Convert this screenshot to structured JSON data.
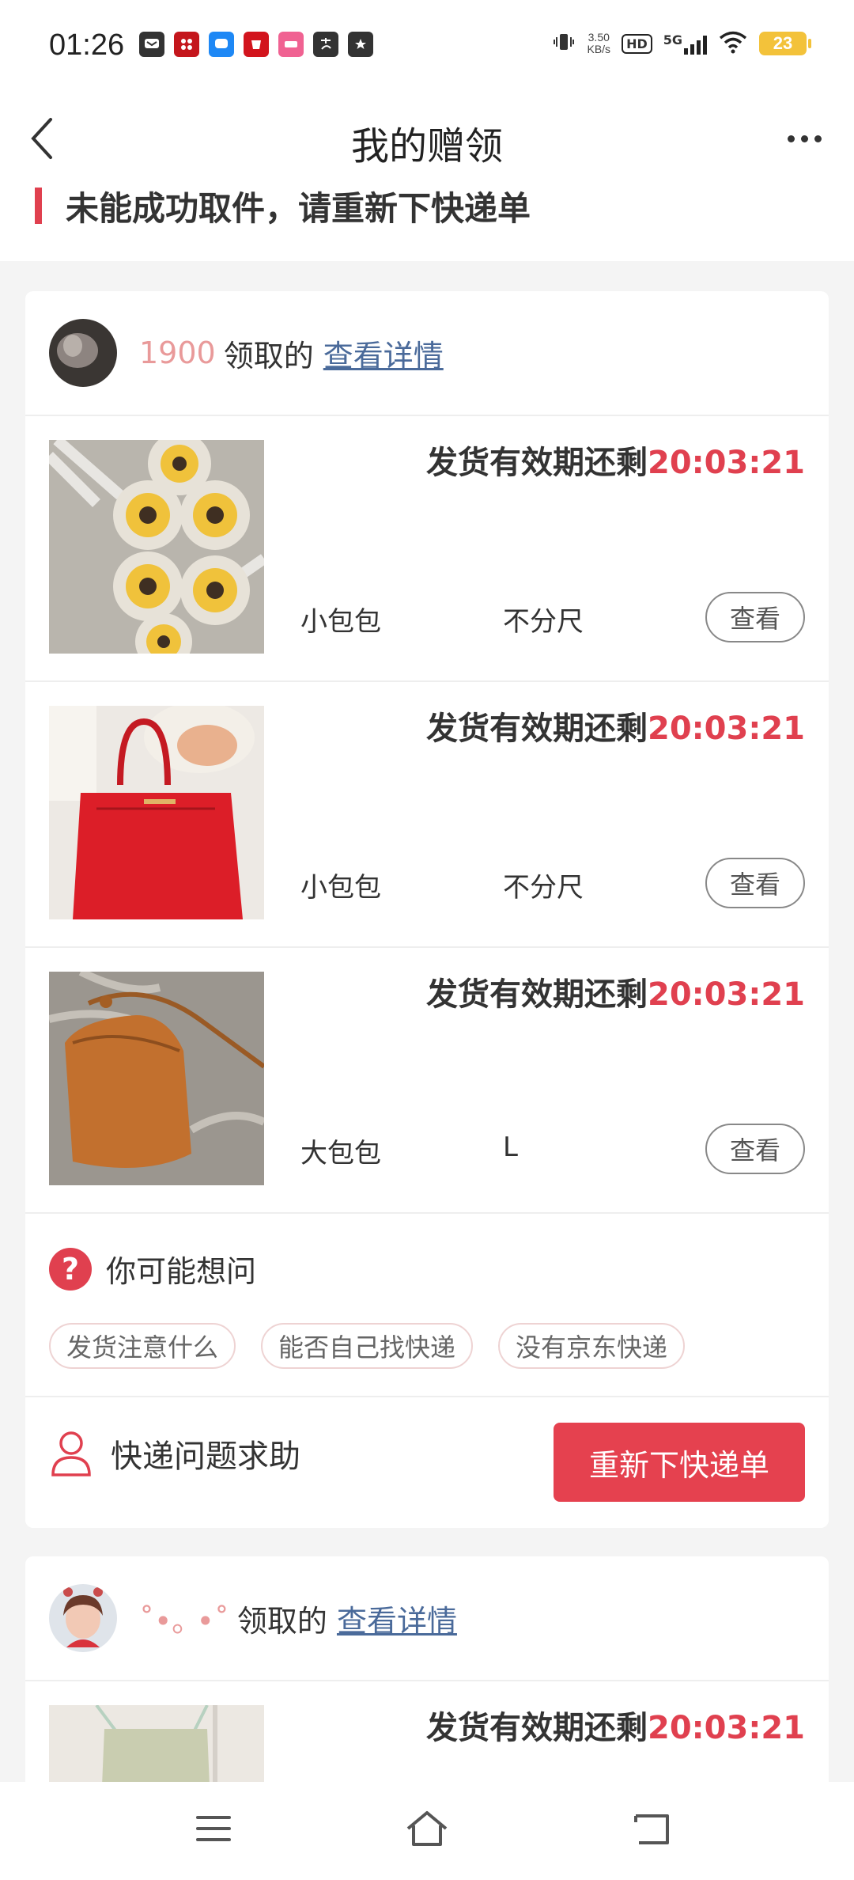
{
  "status_bar": {
    "time": "01:26",
    "net_speed_value": "3.50",
    "net_speed_unit": "KB/s",
    "hd_label": "HD",
    "network": "5G",
    "battery": "23"
  },
  "nav": {
    "title": "我的赠领"
  },
  "banner": {
    "text": "未能成功取件，请重新下快递单"
  },
  "cards": [
    {
      "user_name": "1900",
      "received_label": "领取的",
      "detail_link": "查看详情",
      "items": [
        {
          "ship_label": "发货有效期还剩",
          "countdown": "20:03:21",
          "name": "小包包",
          "size": "不分尺",
          "view_label": "查看"
        },
        {
          "ship_label": "发货有效期还剩",
          "countdown": "20:03:21",
          "name": "小包包",
          "size": "不分尺",
          "view_label": "查看"
        },
        {
          "ship_label": "发货有效期还剩",
          "countdown": "20:03:21",
          "name": "大包包",
          "size": "L",
          "view_label": "查看"
        }
      ],
      "faq": {
        "icon_glyph": "?",
        "title": "你可能想问",
        "chips": [
          "发货注意什么",
          "能否自己找快递",
          "没有京东快递"
        ]
      },
      "help": {
        "label": "快递问题求助",
        "button": "重新下快递单"
      }
    },
    {
      "user_name": "˚•｡ •˚",
      "received_label": "领取的",
      "detail_link": "查看详情",
      "items": [
        {
          "ship_label": "发货有效期还剩",
          "countdown": "20:03:21"
        }
      ]
    }
  ],
  "colors": {
    "accent": "#e5414f",
    "link": "#4a6a9a",
    "username": "#e99a9a"
  }
}
